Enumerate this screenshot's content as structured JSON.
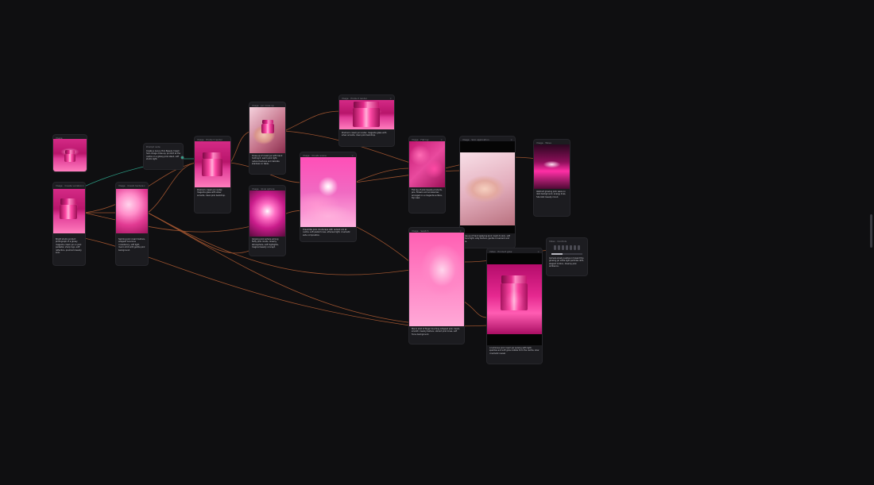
{
  "canvas": {
    "background": "#0f0f11",
    "wire_color": "#c8683a",
    "wire_color_teal": "#2ea38a"
  },
  "nodes": [
    {
      "id": "n1",
      "title": "Image",
      "caption": ""
    },
    {
      "id": "n2",
      "title": "Prompt node",
      "caption": "Create a luxury Pink Beauty Cream hero image close-up, product at the centre on a glossy pink stand, soft studio light."
    },
    {
      "id": "n3",
      "title": "Image · Create variation",
      "caption": "Bright studio product photograph of a glossy magenta cream jar on pink pedestal, sharp logo, soft reflection, premium beauty look."
    },
    {
      "id": "n4",
      "title": "Image · Cream texture",
      "caption": "Swirling pink cream texture, whipped luxurious consistency, soft light, macro shot with gentle pink background."
    },
    {
      "id": "n5",
      "title": "Image · Jar close-up",
      "caption": "Close-up of cream jar with hand holding it, warm pink light, natural textures and delicate shadows on table."
    },
    {
      "id": "n6",
      "title": "Image · Glow sphere",
      "caption": "Glowing pink sphere among fluffy pink clouds, dreamy atmosphere, soft highlights, magical beauty concept."
    },
    {
      "id": "n7",
      "title": "Image · Clouds scene",
      "caption": "Dreamlike pink cloudscape with radiant orb at centre, soft pastel tones, ethereal light, cinematic wide composition."
    },
    {
      "id": "n8",
      "title": "Image · Product render",
      "caption": "Premium cream jar render, magenta glass with silver accents, clean pink backdrop."
    },
    {
      "id": "n9",
      "title": "Image · Flat lay",
      "caption": "Flat lay of pink beauty products, jars, flowers and accessories arranged on a magenta surface, top view."
    },
    {
      "id": "n10",
      "title": "Image · Skin application",
      "caption": "Close-up of hand applying pink cream to skin, soft natural light, silky texture, gentle movement and care."
    },
    {
      "id": "n11",
      "title": "Image · Wave",
      "caption": "Abstract glowing pink wave on dark background, energy lines, futuristic beauty mood."
    },
    {
      "id": "n12",
      "title": "Image · Swatch",
      "caption": "Macro shot of finger touching whipped pink cream, smooth creamy texture, vibrant pink tones, soft focus background."
    },
    {
      "id": "n13",
      "title": "Video · Product glow",
      "caption": "A luminous pink cream jar pulsing with light, sparkles and soft glow radiate from the centre, slow cinematic reveal."
    },
    {
      "id": "n14",
      "title": "Video · Controls",
      "caption": "Camera slowly pushes in toward the glowing jar while light particles drift, elegant motion, dreamy pink ambience."
    }
  ],
  "video_controls": {
    "progress": 0.35
  }
}
